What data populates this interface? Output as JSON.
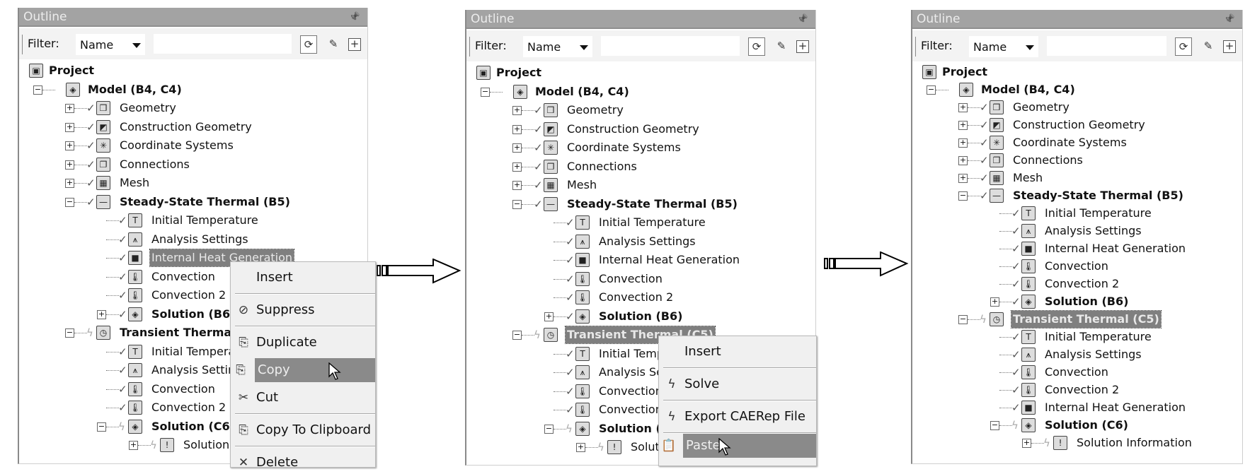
{
  "panels": [
    {
      "title": "Outline",
      "filter_label": "Filter:",
      "filter_value": "Name",
      "filter_text": "",
      "tree": [
        {
          "label": "Project",
          "level": 0,
          "icon": "project-icon",
          "glyph": "▣",
          "bold": true
        },
        {
          "label": "Model (B4, C4)",
          "level": 1,
          "expander": "minus",
          "icon": "model-icon",
          "glyph": "◈",
          "bold": true
        },
        {
          "label": "Geometry",
          "level": 2,
          "expander": "plus",
          "status": "check",
          "icon": "geometry-icon",
          "glyph": "❒"
        },
        {
          "label": "Construction Geometry",
          "level": 2,
          "expander": "plus",
          "status": "check",
          "icon": "construction-geometry-icon",
          "glyph": "◩"
        },
        {
          "label": "Coordinate Systems",
          "level": 2,
          "expander": "plus",
          "status": "check",
          "icon": "coordinate-systems-icon",
          "glyph": "✳"
        },
        {
          "label": "Connections",
          "level": 2,
          "expander": "plus",
          "status": "check",
          "icon": "connections-icon",
          "glyph": "❐"
        },
        {
          "label": "Mesh",
          "level": 2,
          "expander": "plus",
          "status": "check",
          "icon": "mesh-icon",
          "glyph": "▦"
        },
        {
          "label": "Steady-State Thermal (B5)",
          "level": 2,
          "expander": "minus",
          "status": "check",
          "icon": "steady-state-thermal-icon",
          "glyph": "—",
          "bold": true
        },
        {
          "label": "Initial Temperature",
          "level": 3,
          "status": "check",
          "icon": "initial-temperature-icon",
          "glyph": "T"
        },
        {
          "label": "Analysis Settings",
          "level": 3,
          "status": "check",
          "icon": "analysis-settings-icon",
          "glyph": "⩚"
        },
        {
          "label": "Internal Heat Generation",
          "level": 3,
          "status": "check",
          "icon": "internal-heat-generation-icon",
          "glyph": "■",
          "selected": true
        },
        {
          "label": "Convection",
          "level": 3,
          "status": "check",
          "icon": "convection-icon",
          "glyph": "🌡"
        },
        {
          "label": "Convection 2",
          "level": 3,
          "status": "check",
          "icon": "convection-icon",
          "glyph": "🌡"
        },
        {
          "label": "Solution (B6)",
          "level": 3,
          "expander": "plus",
          "status": "check",
          "icon": "solution-icon",
          "glyph": "◈",
          "bold": true
        },
        {
          "label": "Transient Thermal (C5)",
          "level": 2,
          "expander": "minus",
          "status": "pending",
          "icon": "transient-thermal-icon",
          "glyph": "◷",
          "bold": true
        },
        {
          "label": "Initial Temperature",
          "level": 3,
          "status": "check",
          "icon": "initial-temperature-icon",
          "glyph": "T"
        },
        {
          "label": "Analysis Settings",
          "level": 3,
          "status": "check",
          "icon": "analysis-settings-icon",
          "glyph": "⩚"
        },
        {
          "label": "Convection",
          "level": 3,
          "status": "check",
          "icon": "convection-icon",
          "glyph": "🌡"
        },
        {
          "label": "Convection 2",
          "level": 3,
          "status": "check",
          "icon": "convection-icon",
          "glyph": "🌡"
        },
        {
          "label": "Solution (C6)",
          "level": 3,
          "expander": "minus",
          "status": "pending",
          "icon": "solution-icon",
          "glyph": "◈",
          "bold": true
        },
        {
          "label": "Solution Information",
          "level": 4,
          "expander": "plus",
          "status": "pending",
          "icon": "solution-information-icon",
          "glyph": "!"
        }
      ],
      "context_menu": [
        {
          "label": "Insert",
          "icon": ""
        },
        {
          "sep": true
        },
        {
          "label": "Suppress",
          "icon": "suppress-icon",
          "glyph": "⊘"
        },
        {
          "sep": true
        },
        {
          "label": "Duplicate",
          "icon": "duplicate-icon",
          "glyph": "⎘"
        },
        {
          "label": "Copy",
          "icon": "copy-icon",
          "glyph": "⎘",
          "highlighted": true
        },
        {
          "label": "Cut",
          "icon": "cut-icon",
          "glyph": "✂"
        },
        {
          "sep": true
        },
        {
          "label": "Copy To Clipboard",
          "icon": "copy-to-clipboard-icon",
          "glyph": "⎘"
        },
        {
          "sep": true
        },
        {
          "label": "Delete",
          "icon": "delete-icon",
          "glyph": "✕"
        }
      ]
    },
    {
      "title": "Outline",
      "filter_label": "Filter:",
      "filter_value": "Name",
      "filter_text": "",
      "tree": [
        {
          "label": "Project",
          "level": 0,
          "icon": "project-icon",
          "glyph": "▣",
          "bold": true
        },
        {
          "label": "Model (B4, C4)",
          "level": 1,
          "expander": "minus",
          "icon": "model-icon",
          "glyph": "◈",
          "bold": true
        },
        {
          "label": "Geometry",
          "level": 2,
          "expander": "plus",
          "status": "check",
          "icon": "geometry-icon",
          "glyph": "❒"
        },
        {
          "label": "Construction Geometry",
          "level": 2,
          "expander": "plus",
          "status": "check",
          "icon": "construction-geometry-icon",
          "glyph": "◩"
        },
        {
          "label": "Coordinate Systems",
          "level": 2,
          "expander": "plus",
          "status": "check",
          "icon": "coordinate-systems-icon",
          "glyph": "✳"
        },
        {
          "label": "Connections",
          "level": 2,
          "expander": "plus",
          "status": "check",
          "icon": "connections-icon",
          "glyph": "❐"
        },
        {
          "label": "Mesh",
          "level": 2,
          "expander": "plus",
          "status": "check",
          "icon": "mesh-icon",
          "glyph": "▦"
        },
        {
          "label": "Steady-State Thermal (B5)",
          "level": 2,
          "expander": "minus",
          "status": "check",
          "icon": "steady-state-thermal-icon",
          "glyph": "—",
          "bold": true
        },
        {
          "label": "Initial Temperature",
          "level": 3,
          "status": "check",
          "icon": "initial-temperature-icon",
          "glyph": "T"
        },
        {
          "label": "Analysis Settings",
          "level": 3,
          "status": "check",
          "icon": "analysis-settings-icon",
          "glyph": "⩚"
        },
        {
          "label": "Internal Heat Generation",
          "level": 3,
          "status": "check",
          "icon": "internal-heat-generation-icon",
          "glyph": "■"
        },
        {
          "label": "Convection",
          "level": 3,
          "status": "check",
          "icon": "convection-icon",
          "glyph": "🌡"
        },
        {
          "label": "Convection 2",
          "level": 3,
          "status": "check",
          "icon": "convection-icon",
          "glyph": "🌡"
        },
        {
          "label": "Solution (B6)",
          "level": 3,
          "expander": "plus",
          "status": "check",
          "icon": "solution-icon",
          "glyph": "◈",
          "bold": true
        },
        {
          "label": "Transient Thermal (C5)",
          "level": 2,
          "expander": "minus",
          "status": "pending",
          "icon": "transient-thermal-icon",
          "glyph": "◷",
          "bold": true,
          "selected": true
        },
        {
          "label": "Initial Temperature",
          "level": 3,
          "status": "check",
          "icon": "initial-temperature-icon",
          "glyph": "T"
        },
        {
          "label": "Analysis Settings",
          "level": 3,
          "status": "check",
          "icon": "analysis-settings-icon",
          "glyph": "⩚"
        },
        {
          "label": "Convection",
          "level": 3,
          "status": "check",
          "icon": "convection-icon",
          "glyph": "🌡"
        },
        {
          "label": "Convection 2",
          "level": 3,
          "status": "check",
          "icon": "convection-icon",
          "glyph": "🌡"
        },
        {
          "label": "Solution (C6)",
          "level": 3,
          "expander": "minus",
          "status": "pending",
          "icon": "solution-icon",
          "glyph": "◈",
          "bold": true
        },
        {
          "label": "Solution Information",
          "level": 4,
          "expander": "plus",
          "status": "pending",
          "icon": "solution-information-icon",
          "glyph": "!"
        }
      ],
      "context_menu": [
        {
          "label": "Insert",
          "icon": ""
        },
        {
          "sep": true
        },
        {
          "label": "Solve",
          "icon": "solve-icon",
          "glyph": "ϟ"
        },
        {
          "sep": true
        },
        {
          "label": "Export CAERep File",
          "icon": "export-icon",
          "glyph": "ϟ"
        },
        {
          "sep": true
        },
        {
          "label": "Paste",
          "icon": "paste-icon",
          "glyph": "📋",
          "highlighted": true
        }
      ]
    },
    {
      "title": "Outline",
      "filter_label": "Filter:",
      "filter_value": "Name",
      "filter_text": "",
      "tree": [
        {
          "label": "Project",
          "level": 0,
          "icon": "project-icon",
          "glyph": "▣",
          "bold": true
        },
        {
          "label": "Model (B4, C4)",
          "level": 1,
          "expander": "minus",
          "icon": "model-icon",
          "glyph": "◈",
          "bold": true
        },
        {
          "label": "Geometry",
          "level": 2,
          "expander": "plus",
          "status": "check",
          "icon": "geometry-icon",
          "glyph": "❒"
        },
        {
          "label": "Construction Geometry",
          "level": 2,
          "expander": "plus",
          "status": "check",
          "icon": "construction-geometry-icon",
          "glyph": "◩"
        },
        {
          "label": "Coordinate Systems",
          "level": 2,
          "expander": "plus",
          "status": "check",
          "icon": "coordinate-systems-icon",
          "glyph": "✳"
        },
        {
          "label": "Connections",
          "level": 2,
          "expander": "plus",
          "status": "check",
          "icon": "connections-icon",
          "glyph": "❐"
        },
        {
          "label": "Mesh",
          "level": 2,
          "expander": "plus",
          "status": "check",
          "icon": "mesh-icon",
          "glyph": "▦"
        },
        {
          "label": "Steady-State Thermal (B5)",
          "level": 2,
          "expander": "minus",
          "status": "check",
          "icon": "steady-state-thermal-icon",
          "glyph": "—",
          "bold": true
        },
        {
          "label": "Initial Temperature",
          "level": 3,
          "status": "check",
          "icon": "initial-temperature-icon",
          "glyph": "T"
        },
        {
          "label": "Analysis Settings",
          "level": 3,
          "status": "check",
          "icon": "analysis-settings-icon",
          "glyph": "⩚"
        },
        {
          "label": "Internal Heat Generation",
          "level": 3,
          "status": "check",
          "icon": "internal-heat-generation-icon",
          "glyph": "■"
        },
        {
          "label": "Convection",
          "level": 3,
          "status": "check",
          "icon": "convection-icon",
          "glyph": "🌡"
        },
        {
          "label": "Convection 2",
          "level": 3,
          "status": "check",
          "icon": "convection-icon",
          "glyph": "🌡"
        },
        {
          "label": "Solution (B6)",
          "level": 3,
          "expander": "plus",
          "status": "check",
          "icon": "solution-icon",
          "glyph": "◈",
          "bold": true
        },
        {
          "label": "Transient Thermal (C5)",
          "level": 2,
          "expander": "minus",
          "status": "pending",
          "icon": "transient-thermal-icon",
          "glyph": "◷",
          "bold": true,
          "selected": true
        },
        {
          "label": "Initial Temperature",
          "level": 3,
          "status": "check",
          "icon": "initial-temperature-icon",
          "glyph": "T"
        },
        {
          "label": "Analysis Settings",
          "level": 3,
          "status": "check",
          "icon": "analysis-settings-icon",
          "glyph": "⩚"
        },
        {
          "label": "Convection",
          "level": 3,
          "status": "check",
          "icon": "convection-icon",
          "glyph": "🌡"
        },
        {
          "label": "Convection 2",
          "level": 3,
          "status": "check",
          "icon": "convection-icon",
          "glyph": "🌡"
        },
        {
          "label": "Internal Heat Generation",
          "level": 3,
          "status": "check",
          "icon": "internal-heat-generation-icon",
          "glyph": "■"
        },
        {
          "label": "Solution (C6)",
          "level": 3,
          "expander": "minus",
          "status": "pending",
          "icon": "solution-icon",
          "glyph": "◈",
          "bold": true
        },
        {
          "label": "Solution Information",
          "level": 4,
          "expander": "plus",
          "status": "pending",
          "icon": "solution-information-icon",
          "glyph": "!"
        }
      ]
    }
  ],
  "colors": {
    "title_bar": "#a3a3a3",
    "selection": "#7f7f7f",
    "menu_highlight": "#8a8a8a"
  }
}
